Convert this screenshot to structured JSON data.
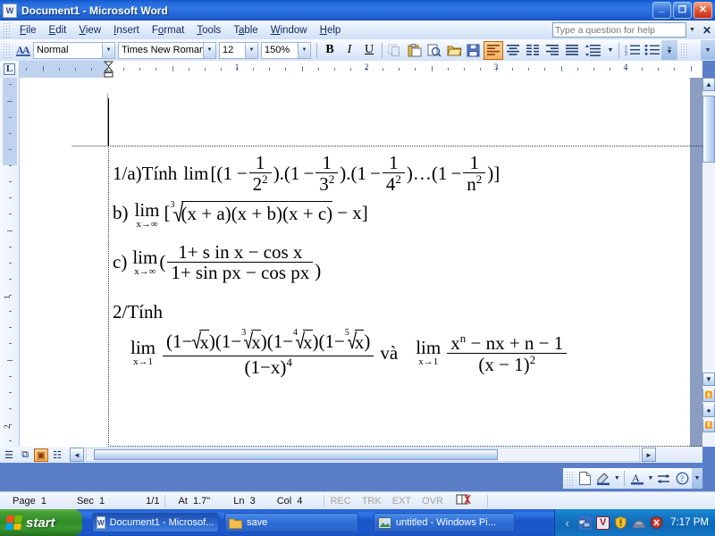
{
  "window": {
    "title": "Document1 - Microsoft Word",
    "icon": "word-document-icon",
    "minimize": "_",
    "maximize": "❐",
    "close": "✕"
  },
  "menubar": {
    "items": [
      {
        "label": "File",
        "accel": "F"
      },
      {
        "label": "Edit",
        "accel": "E"
      },
      {
        "label": "View",
        "accel": "V"
      },
      {
        "label": "Insert",
        "accel": "I"
      },
      {
        "label": "Format",
        "accel": "o"
      },
      {
        "label": "Tools",
        "accel": "T"
      },
      {
        "label": "Table",
        "accel": "a"
      },
      {
        "label": "Window",
        "accel": "W"
      },
      {
        "label": "Help",
        "accel": "H"
      }
    ],
    "ask_placeholder": "Type a question for help",
    "ask_value": "",
    "close_pane": "✕"
  },
  "toolbar": {
    "style_value": "Normal",
    "font_value": "Times New Roman",
    "size_value": "12",
    "zoom_value": "150%",
    "bold": "B",
    "italic": "I",
    "underline": "U",
    "buttons": [
      {
        "name": "copy-button",
        "label": "Copy",
        "state": "disabled"
      },
      {
        "name": "paste-button",
        "label": "Paste",
        "state": "normal"
      },
      {
        "name": "print-preview-button",
        "label": "Print Preview",
        "state": "normal"
      },
      {
        "name": "open-button",
        "label": "Open",
        "state": "normal"
      },
      {
        "name": "save-button",
        "label": "Save",
        "state": "normal"
      },
      {
        "name": "align-left-button",
        "label": "Align Left",
        "state": "active"
      },
      {
        "name": "align-center-button",
        "label": "Center",
        "state": "normal"
      },
      {
        "name": "align-justify-low-button",
        "label": "Distributed",
        "state": "normal"
      },
      {
        "name": "align-right-button",
        "label": "Align Right",
        "state": "normal"
      },
      {
        "name": "justify-button",
        "label": "Justify",
        "state": "normal"
      },
      {
        "name": "line-spacing-button",
        "label": "Line Spacing",
        "state": "normal"
      },
      {
        "name": "numbering-button",
        "label": "Numbering",
        "state": "normal"
      },
      {
        "name": "bullets-button",
        "label": "Bullets",
        "state": "normal"
      }
    ],
    "overflow_label": "Toolbar Options"
  },
  "ruler": {
    "horizontal_numbers": [
      "1",
      "2",
      "3",
      "4"
    ],
    "vertical_numbers": [
      "1",
      "2"
    ],
    "tab_stop_type": "L"
  },
  "document": {
    "lines": [
      {
        "id": "line-1a",
        "prefix": "1/a)Tính",
        "operator": "lim",
        "text": "1/a)Tính lim[(1 − 1/2² ).(1 − 1/3² ).(1 − 1/4² )…(1 − 1/n² )]",
        "tokens": {
          "open": "[(1",
          "minus": "−",
          "one": "1",
          "d1": "2",
          "d2": "3",
          "d3": "4",
          "d4": "n",
          "exp": "2",
          "mid1": ").(1",
          "mid2": ").(1",
          "mid3": ")…(1",
          "close": ")]"
        }
      },
      {
        "id": "line-b",
        "text": "b) lim[∛(x + a)(x + b)(x + c) − x]",
        "tokens": {
          "label": "b)",
          "lim": "lim",
          "sub": "x→∞",
          "open": "[",
          "index": "3",
          "radicand": "(x + a)(x + b)(x + c)",
          "tail": "− x]"
        }
      },
      {
        "id": "line-c",
        "text": "c) lim( (1+ s in x − cos x) / (1+ sin px − cos px) )",
        "tokens": {
          "label": "c)",
          "lim": "lim",
          "sub": "x→∞",
          "open": "(",
          "numerator": "1+ s in x − cos x",
          "denominator": "1+ sin px − cos px",
          "close": ")"
        }
      },
      {
        "id": "line-2",
        "text": "2/Tính"
      },
      {
        "id": "line-3",
        "text": "lim (1−√x)(1−∛x)(1−∜x)(1−⁵√x) / (1−x)⁴  và  lim (xⁿ − nx + n − 1)/(x−1)²",
        "tokens": {
          "lim1": "lim",
          "sub1": "x→1",
          "n_f1": "(1−",
          "n_r1_idx": "",
          "n_r2_idx": "3",
          "n_r3_idx": "4",
          "n_r4_idx": "5",
          "radicand": "x",
          "close_paren": ")",
          "den1": "(1−x)",
          "den1_exp": "4",
          "va": "và",
          "lim2": "lim",
          "sub2": "x→1",
          "num2_a": "x",
          "num2_exp": "n",
          "num2_b": "− nx + n − 1",
          "den2": "(x − 1)",
          "den2_exp": "2"
        }
      }
    ]
  },
  "viewbar": {
    "buttons": [
      {
        "name": "normal-view-button",
        "glyph": "☰",
        "selected": false
      },
      {
        "name": "web-layout-view-button",
        "glyph": "⧉",
        "selected": false
      },
      {
        "name": "print-layout-view-button",
        "glyph": "▣",
        "selected": true
      },
      {
        "name": "outline-view-button",
        "glyph": "☷",
        "selected": false
      },
      {
        "name": "reading-layout-view-button",
        "glyph": "⌽",
        "selected": false
      }
    ]
  },
  "mini_toolbar": {
    "buttons": [
      {
        "name": "new-document-button",
        "label": "New"
      },
      {
        "name": "highlight-color-button",
        "label": "Highlight"
      },
      {
        "name": "highlight-dropdown-button",
        "label": "Highlight options"
      },
      {
        "name": "font-color-button",
        "label": "Font Color"
      },
      {
        "name": "font-color-dropdown-button",
        "label": "Font color options"
      },
      {
        "name": "arrows-button",
        "label": "Arrows"
      },
      {
        "name": "help-button",
        "label": "Help"
      }
    ]
  },
  "statusbar": {
    "page_label": "Page",
    "page_value": "1",
    "sec_label": "Sec",
    "sec_value": "1",
    "pages": "1/1",
    "at_label": "At",
    "at_value": "1.7\"",
    "ln_label": "Ln",
    "ln_value": "3",
    "col_label": "Col",
    "col_value": "4",
    "rec": "REC",
    "trk": "TRK",
    "ext": "EXT",
    "ovr": "OVR",
    "spellcheck": "spellcheck-icon"
  },
  "taskbar": {
    "start_label": "start",
    "tasks": [
      {
        "name": "taskbar-item-word",
        "label": "Document1 - Microsof...",
        "icon": "word-document-icon",
        "active": true
      },
      {
        "name": "taskbar-item-save",
        "label": "save",
        "icon": "folder-icon",
        "active": false
      },
      {
        "name": "taskbar-item-picture",
        "label": "untitled - Windows Pi...",
        "icon": "picture-icon",
        "active": false
      }
    ],
    "tray": [
      {
        "name": "show-hidden-icons-button",
        "glyph": "‹",
        "color": "#4f9fe0"
      },
      {
        "name": "network-icon",
        "glyph": "⌕",
        "color": "#3a6fc4"
      },
      {
        "name": "volume-icon",
        "glyph": "V",
        "color": "#d4d4d4"
      },
      {
        "name": "warning-shield-icon",
        "glyph": "!",
        "color": "#e8c032"
      },
      {
        "name": "updates-icon",
        "glyph": "⚙",
        "color": "#8fa0b6"
      },
      {
        "name": "security-alert-icon",
        "glyph": "✕",
        "color": "#c8342a"
      }
    ],
    "clock": "7:17 PM"
  },
  "colors": {
    "titlebar_blue": "#2a6fdd",
    "accent_orange": "#fcb25e",
    "taskbar_blue": "#1b56c8",
    "start_green": "#2f8b27",
    "page_white": "#ffffff"
  }
}
